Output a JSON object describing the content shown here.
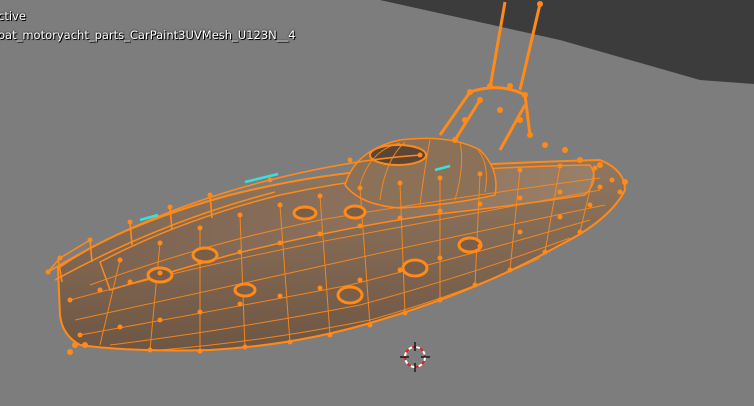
{
  "viewport": {
    "mode_text": "ctive",
    "object_name": "oat_motoryacht_parts_CarPaint3UVMesh_U123N__4"
  },
  "colors": {
    "background": "#7d7d7d",
    "floor_dark": "#3d3d3d",
    "hull": "#8a6f56",
    "wire": "#ff8a1a",
    "seam": "#38e0e0"
  }
}
